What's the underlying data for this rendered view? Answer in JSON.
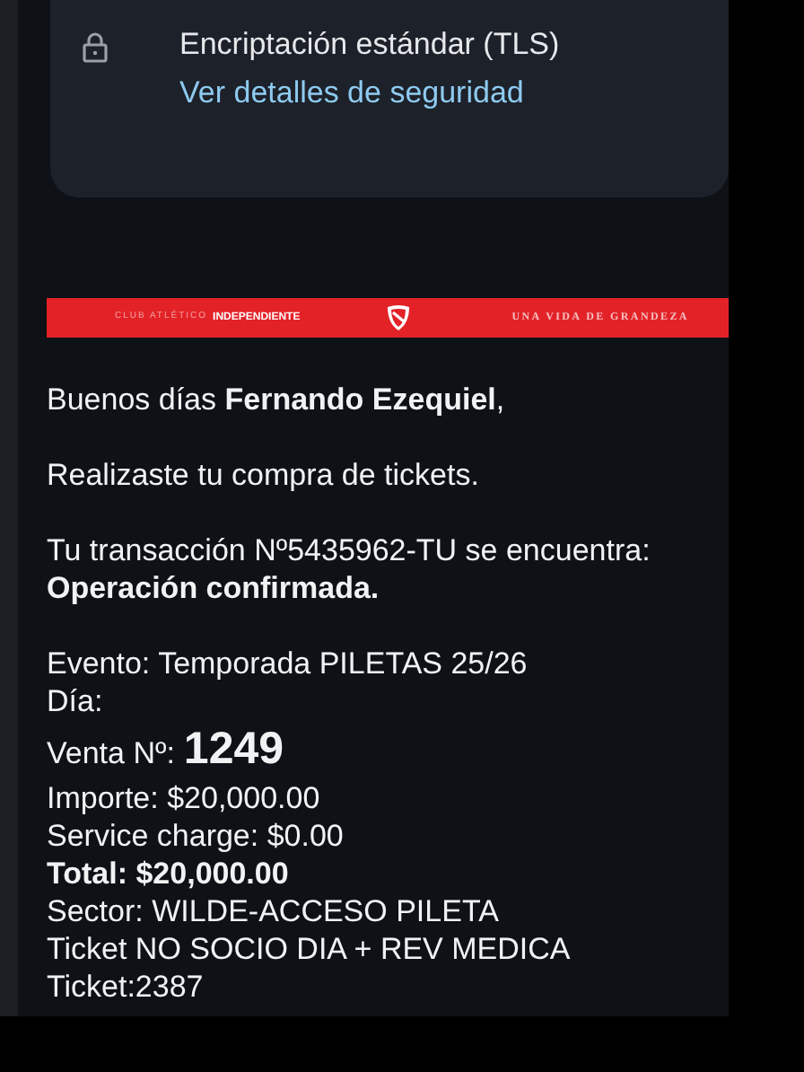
{
  "security": {
    "encryption": "Encriptación estándar (TLS)",
    "link": "Ver detalles de seguridad"
  },
  "banner": {
    "club": "CLUB ATLÉTICO",
    "brand": "INDEPENDIENTE",
    "motto": "UNA VIDA DE GRANDEZA"
  },
  "paragraphs": [
    [
      {
        "kind": "text",
        "text": "Buenos días **Fernando Ezequiel**,"
      }
    ],
    [
      {
        "kind": "text",
        "text": "Realizaste tu compra de tickets."
      }
    ],
    [
      {
        "kind": "text",
        "text": "Tu transacción Nº5435962-TU se encuentra:"
      },
      {
        "kind": "bold",
        "text": "Operación confirmada."
      }
    ],
    [
      {
        "kind": "text",
        "text": "Evento: Temporada PILETAS 25/26"
      },
      {
        "kind": "text",
        "text": "Día:"
      },
      {
        "kind": "sale",
        "label": "Venta Nº:",
        "number": "1249"
      },
      {
        "kind": "text",
        "text": "Importe: $20,000.00"
      },
      {
        "kind": "text",
        "text": "Service charge: $0.00"
      },
      {
        "kind": "bold",
        "text": "Total: $20,000.00"
      },
      {
        "kind": "text",
        "text": "Sector: WILDE-ACCESO PILETA"
      },
      {
        "kind": "text",
        "text": "Ticket NO SOCIO DIA + REV MEDICA"
      },
      {
        "kind": "text",
        "text": "Ticket:2387"
      }
    ]
  ]
}
